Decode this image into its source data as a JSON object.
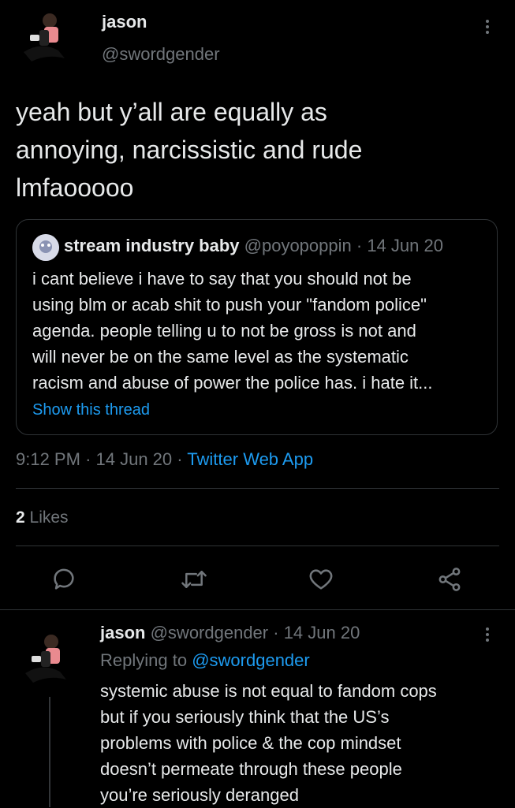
{
  "main_tweet": {
    "author_name": "jason",
    "author_handle": "@swordgender",
    "text_lines": [
      "yeah but y’all are equally as",
      "annoying, narcissistic and rude",
      "lmfaooooo"
    ],
    "quote": {
      "author_name": "stream industry baby",
      "author_handle": "@poyopoppin",
      "date": "· 14 Jun 20",
      "text_lines": [
        "i cant believe i have to say that you should not be",
        "using blm or acab shit to push your \"fandom police\"",
        "agenda. people telling u to not be gross is not and",
        "will never be on the same level as the systematic",
        "racism and abuse of power the police has. i hate it..."
      ],
      "show_thread": "Show this thread"
    },
    "time": "9:12 PM",
    "date": "· 14 Jun 20 ·",
    "source": "Twitter Web App",
    "likes_count": "2",
    "likes_label": "Likes"
  },
  "actions": [
    "reply-icon",
    "retweet-icon",
    "like-icon",
    "share-icon"
  ],
  "reply_tweet": {
    "author_name": "jason",
    "author_handle": "@swordgender",
    "date": "· 14 Jun 20",
    "replying_label": "Replying to",
    "replying_handle": "@swordgender",
    "text_lines": [
      "systemic abuse is not equal to fandom cops",
      "but if you seriously think that the US’s",
      "problems with police & the cop mindset",
      "doesn’t permeate through these people",
      "you’re seriously deranged"
    ]
  },
  "colors": {
    "background": "#000000",
    "text": "#e7e9ea",
    "muted": "#71767b",
    "link": "#1d9bf0",
    "border": "#2f3336"
  }
}
